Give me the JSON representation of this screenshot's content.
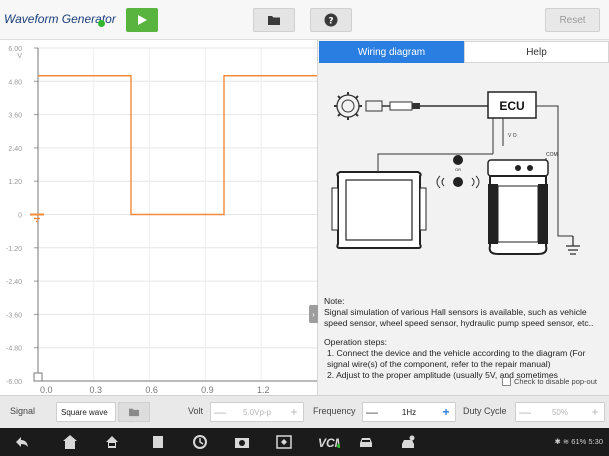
{
  "header": {
    "title": "Waveform Generator",
    "reset_label": "Reset"
  },
  "chart_data": {
    "type": "line",
    "y_ticks": [
      "6.00",
      "4.80",
      "3.60",
      "2.40",
      "1.20",
      "0",
      "-1.20",
      "-2.40",
      "-3.60",
      "-4.80",
      "-6.00"
    ],
    "y_unit": "V",
    "x_ticks": [
      "0.0",
      "0.3",
      "0.6",
      "0.9",
      "1.2"
    ],
    "ylim": [
      -6,
      6
    ],
    "xlim": [
      0,
      1.5
    ],
    "grid": true,
    "series": [
      {
        "color": "#f28a3a",
        "x": [
          0,
          0.5,
          0.5,
          1.0,
          1.0,
          1.5
        ],
        "y": [
          5.0,
          5.0,
          0,
          0,
          5.0,
          5.0
        ]
      }
    ]
  },
  "panel": {
    "tabs": [
      {
        "label": "Wiring diagram",
        "active": true
      },
      {
        "label": "Help",
        "active": false
      }
    ],
    "diagram_labels": {
      "ecu": "ECU",
      "vo": "V O",
      "com": "COM"
    },
    "note_title": "Note:",
    "note_body": "Signal simulation of various Hall sensors is available, such as vehicle speed sensor, wheel speed sensor, hydraulic pump speed sensor, etc..",
    "steps_title": "Operation steps:",
    "step1": "1. Connect the device and the vehicle according to the diagram (For signal wire(s) of the component, refer to the repair manual)",
    "step2": "2. Adjust to the proper amplitude (usually 5V, and sometimes",
    "popout_label": "Check to disable pop-out"
  },
  "controls": {
    "signal_label": "Signal",
    "signal_value": "Square wave",
    "volt_label": "Volt",
    "volt_value": "5.0Vp-p",
    "frequency_label": "Frequency",
    "frequency_value": "1Hz",
    "duty_label": "Duty Cycle",
    "duty_value": "50%",
    "minus": "—",
    "plus": "+"
  },
  "statusbar": {
    "text": "61%",
    "time": "5:30"
  },
  "colors": {
    "accent": "#2a7de1",
    "play": "#58b43f",
    "waveform": "#f28a3a",
    "title": "#1a3e78"
  }
}
